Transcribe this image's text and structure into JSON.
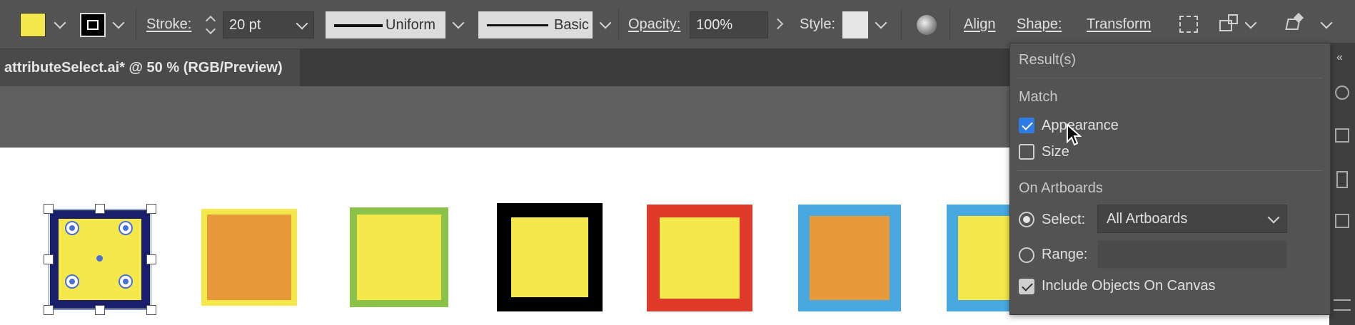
{
  "toolbar": {
    "stroke_label": "Stroke:",
    "stroke_weight": "20 pt",
    "profile_label": "Uniform",
    "brush_label": "Basic",
    "opacity_label": "Opacity:",
    "opacity_value": "100%",
    "style_label": "Style:",
    "align_link": "Align",
    "shape_link": "Shape:",
    "transform_link": "Transform",
    "fill_color": "#f5e84a"
  },
  "document_tab": {
    "title": "attributeSelect.ai* @ 50 % (RGB/Preview)"
  },
  "panel": {
    "results_label": "Result(s)",
    "match_heading": "Match",
    "appearance_label": "Appearance",
    "appearance_checked": true,
    "size_label": "Size",
    "size_checked": false,
    "on_artboards_heading": "On Artboards",
    "select_label": "Select:",
    "select_value": "All Artboards",
    "range_label": "Range:",
    "range_value": "",
    "include_label": "Include Objects On Canvas",
    "include_checked": true
  },
  "canvas_shapes": [
    {
      "fill": "#f5e84a",
      "stroke": "#1a1f6b",
      "selected": true
    },
    {
      "fill": "#e89a3a",
      "stroke": "#f5e84a"
    },
    {
      "fill": "#f5e84a",
      "stroke": "#8bc34a"
    },
    {
      "fill": "#f5e84a",
      "stroke": "#000000"
    },
    {
      "fill": "#f5e84a",
      "stroke": "#e03a2a"
    },
    {
      "fill": "#e89a3a",
      "stroke": "#4aa8e0"
    },
    {
      "fill": "#f5e84a",
      "stroke": "#4aa8e0"
    }
  ]
}
